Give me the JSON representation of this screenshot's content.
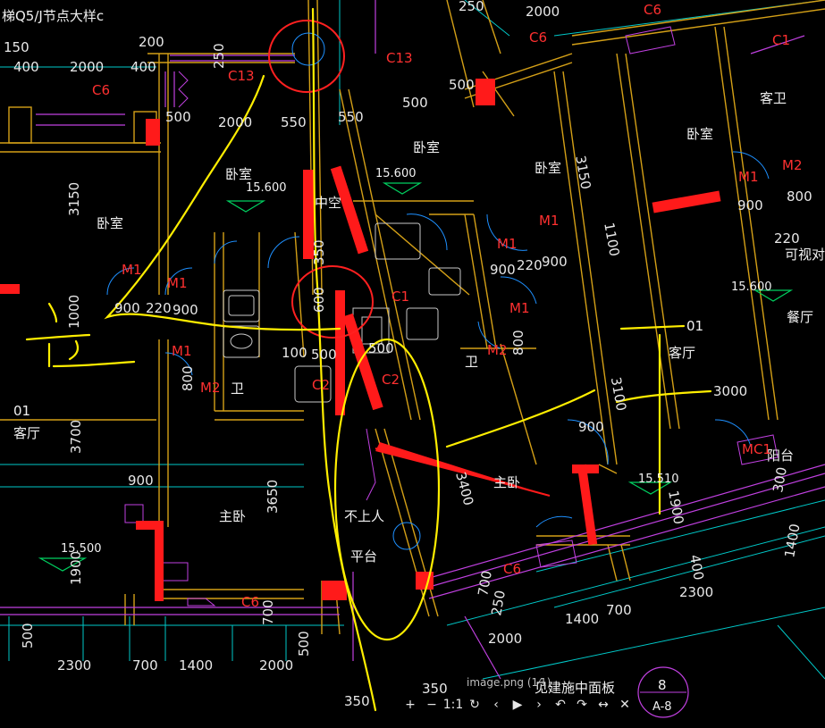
{
  "viewer": {
    "caption": "image.png (1⁄1)",
    "toolbar": [
      {
        "name": "zoom-in-button",
        "glyph": "+"
      },
      {
        "name": "zoom-out-button",
        "glyph": "−"
      },
      {
        "name": "actual-size-button",
        "glyph": "1:1"
      },
      {
        "name": "refresh-button",
        "glyph": "↻"
      },
      {
        "name": "previous-button",
        "glyph": "‹"
      },
      {
        "name": "play-button",
        "glyph": "▶"
      },
      {
        "name": "next-button",
        "glyph": "›"
      },
      {
        "name": "rotate-left-button",
        "glyph": "↶"
      },
      {
        "name": "rotate-right-button",
        "glyph": "↷"
      },
      {
        "name": "fit-button",
        "glyph": "↔"
      },
      {
        "name": "close-button",
        "glyph": "✕"
      }
    ]
  },
  "drawing": {
    "header": "梯Q5/J节点大样c",
    "section_mark": {
      "number": "8",
      "sheet": "A-8"
    },
    "bottom_right_note": "见建施中面板",
    "rooms": {
      "bedroom": "卧室",
      "master_bedroom": "主卧",
      "living": "客厅",
      "dining": "餐厅",
      "bath": "卫",
      "guest_bath": "客卫",
      "balcony": "阳台",
      "platform": "平台",
      "void": "中空",
      "no_access": "不上人",
      "intercom": "可视对讲",
      "unit_01_left": "01",
      "unit_01_right": "01"
    },
    "tags": {
      "m1": "M1",
      "m2": "M2",
      "c1": "C1",
      "c2": "C2",
      "c6": "C6",
      "c13": "C13",
      "mc1": "MC1"
    },
    "elevations": [
      "15.600",
      "15.600",
      "15.600",
      "15.500",
      "15.510"
    ],
    "dimensions": {
      "d150": "150",
      "d400": "400",
      "d2000": "2000",
      "d200": "200",
      "d250": "250",
      "d500": "500",
      "d550": "550",
      "d700": "700",
      "d3150": "3150",
      "d900": "900",
      "d220": "220",
      "d100": "100",
      "d3700": "3700",
      "d3650": "3650",
      "d1900": "1900",
      "d2300": "2300",
      "d1400": "1400",
      "d350": "350",
      "d800": "800",
      "d3100": "3100",
      "d1100": "1100",
      "d3000": "3000",
      "d1000": "1000",
      "d600": "600",
      "d300": "300",
      "d400b": "400",
      "d3400": "3400"
    }
  }
}
